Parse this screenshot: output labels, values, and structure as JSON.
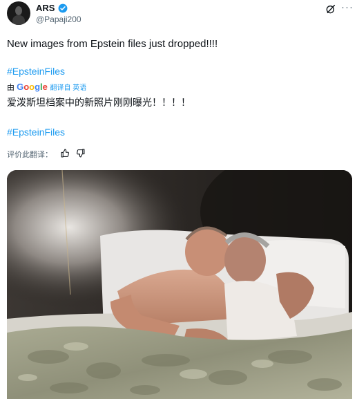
{
  "post": {
    "author_name": "ARS",
    "author_handle": "@Papaji200",
    "text": "New images from Epstein files just dropped!!!!",
    "hashtag_1": "#EpsteinFiles",
    "translation": {
      "prefix": "由",
      "provider": "Google",
      "action_label": "翻译自 英语",
      "translated_text": "爱泼斯坦档案中的新照片刚刚曝光！！！！",
      "hashtag": "#EpsteinFiles"
    },
    "rate_translation_label": "评价此翻译：",
    "more_label": "···"
  },
  "icons": {
    "verified": "verified-badge-icon",
    "grok": "grok-icon",
    "more": "more-icon",
    "thumbs_up": "thumbs-up-icon",
    "thumbs_down": "thumbs-down-icon"
  },
  "colors": {
    "accent": "#1d9bf0",
    "text": "#0f1419",
    "muted": "#536471"
  }
}
